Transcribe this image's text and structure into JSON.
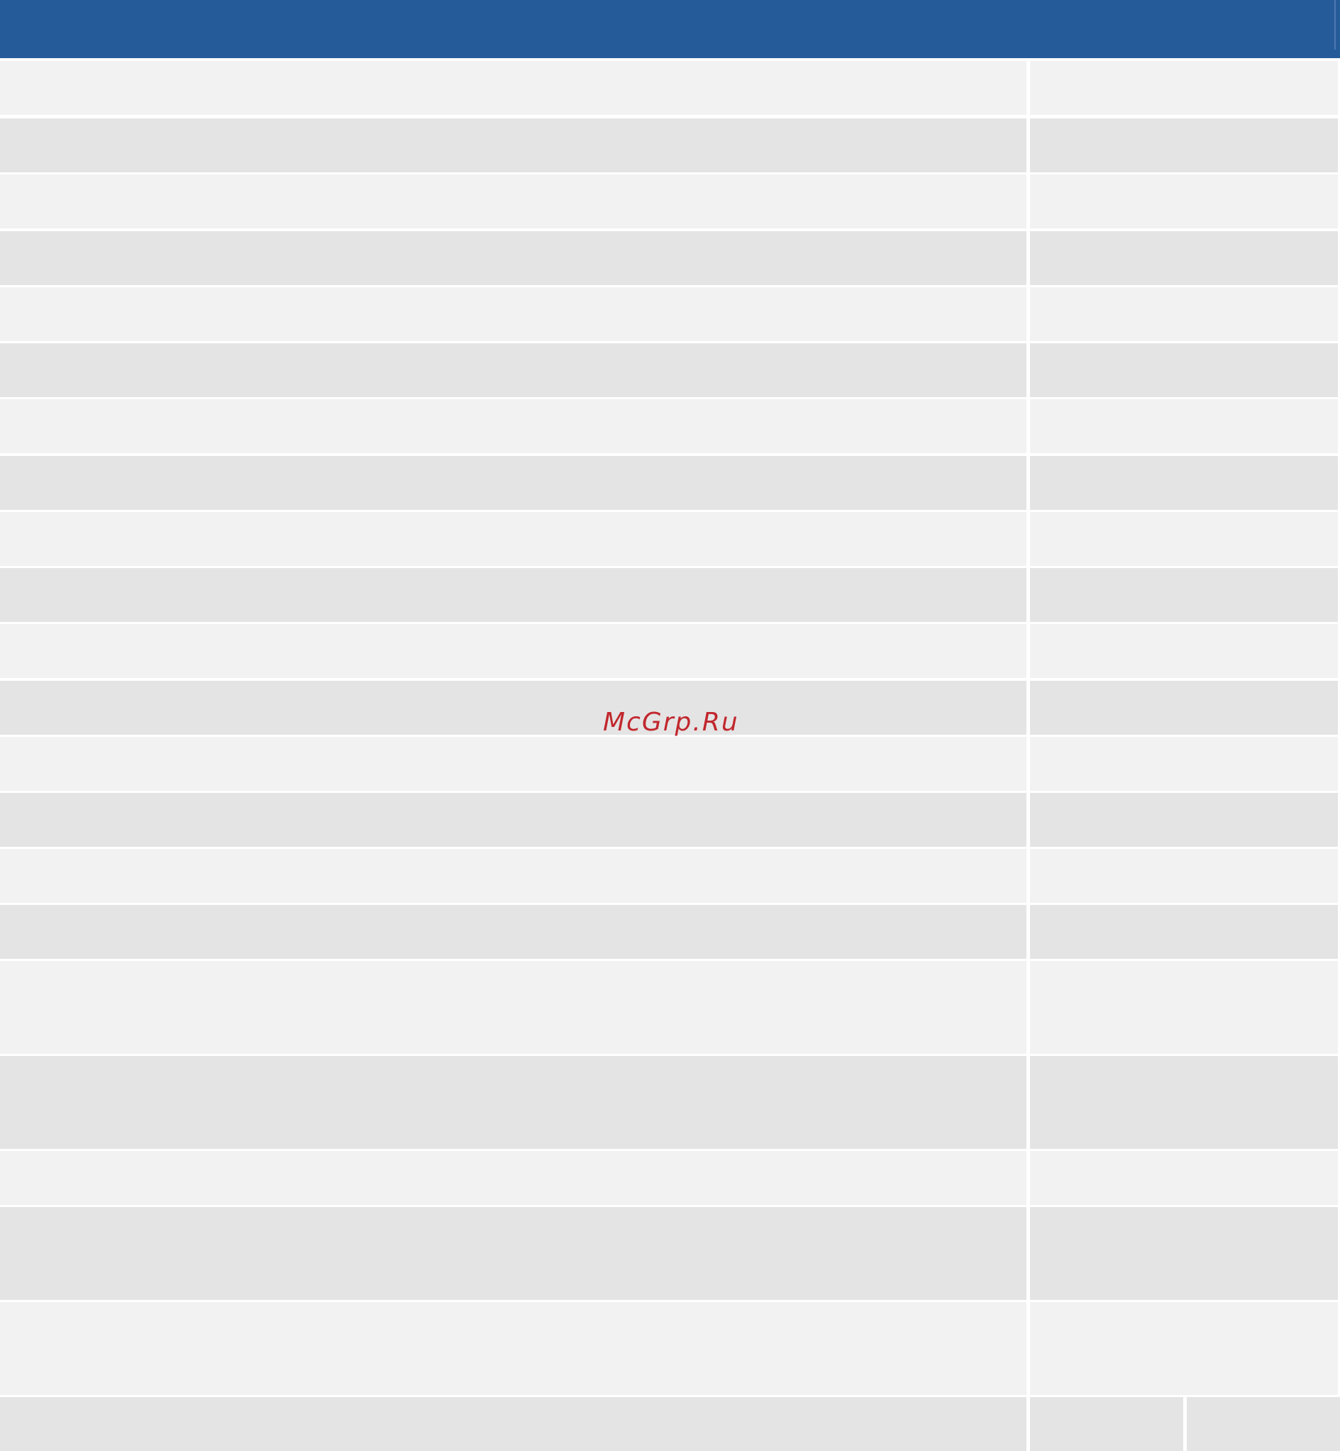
{
  "header": {
    "color": "#265b9a"
  },
  "table": {
    "row_colors": [
      "#f2f2f2",
      "#e4e4e4"
    ],
    "row_count": 24
  },
  "watermark": {
    "text": "McGrp.Ru",
    "color": "#c1272d"
  }
}
